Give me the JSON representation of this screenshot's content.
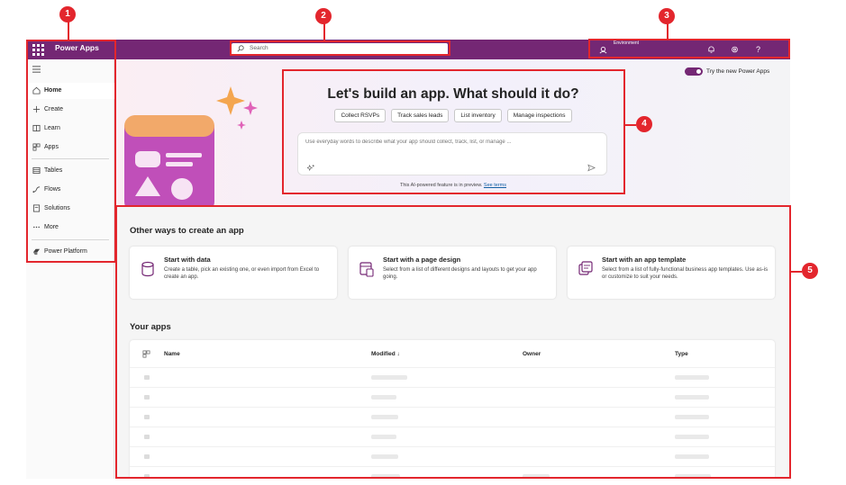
{
  "header": {
    "app_title": "Power Apps",
    "search_placeholder": "Search",
    "environment_label": "Environment",
    "help_glyph": "?"
  },
  "sidebar": {
    "items": [
      {
        "label": "Home",
        "icon": "home-icon",
        "active": true
      },
      {
        "label": "Create",
        "icon": "plus-icon"
      },
      {
        "label": "Learn",
        "icon": "book-icon"
      },
      {
        "label": "Apps",
        "icon": "apps-icon"
      },
      {
        "label": "Tables",
        "icon": "table-icon"
      },
      {
        "label": "Flows",
        "icon": "flow-icon"
      },
      {
        "label": "Solutions",
        "icon": "solution-icon"
      },
      {
        "label": "More",
        "icon": "more-icon"
      },
      {
        "label": "Power Platform",
        "icon": "power-platform-icon"
      }
    ]
  },
  "hero": {
    "toggle_label": "Try the new Power Apps",
    "title": "Let's build an app. What should it do?",
    "suggestions": [
      "Collect RSVPs",
      "Track sales leads",
      "List inventory",
      "Manage inspections"
    ],
    "prompt_placeholder": "Use everyday words to describe what your app should collect, track, list, or manage ...",
    "ai_note": "This AI-powered feature is in preview.",
    "see_terms": "See terms"
  },
  "main": {
    "ways_heading": "Other ways to create an app",
    "cards": [
      {
        "title": "Start with data",
        "desc": "Create a table, pick an existing one, or even import from Excel to create an app."
      },
      {
        "title": "Start with a page design",
        "desc": "Select from a list of different designs and layouts to get your app going."
      },
      {
        "title": "Start with an app template",
        "desc": "Select from a list of fully-functional business app templates. Use as-is or customize to suit your needs."
      }
    ],
    "apps_heading": "Your apps",
    "columns": {
      "name": "Name",
      "modified": "Modified ↓",
      "owner": "Owner",
      "type": "Type"
    }
  },
  "callouts": [
    "1",
    "2",
    "3",
    "4",
    "5"
  ],
  "colors": {
    "brand": "#742774",
    "callout": "#e3262d"
  }
}
